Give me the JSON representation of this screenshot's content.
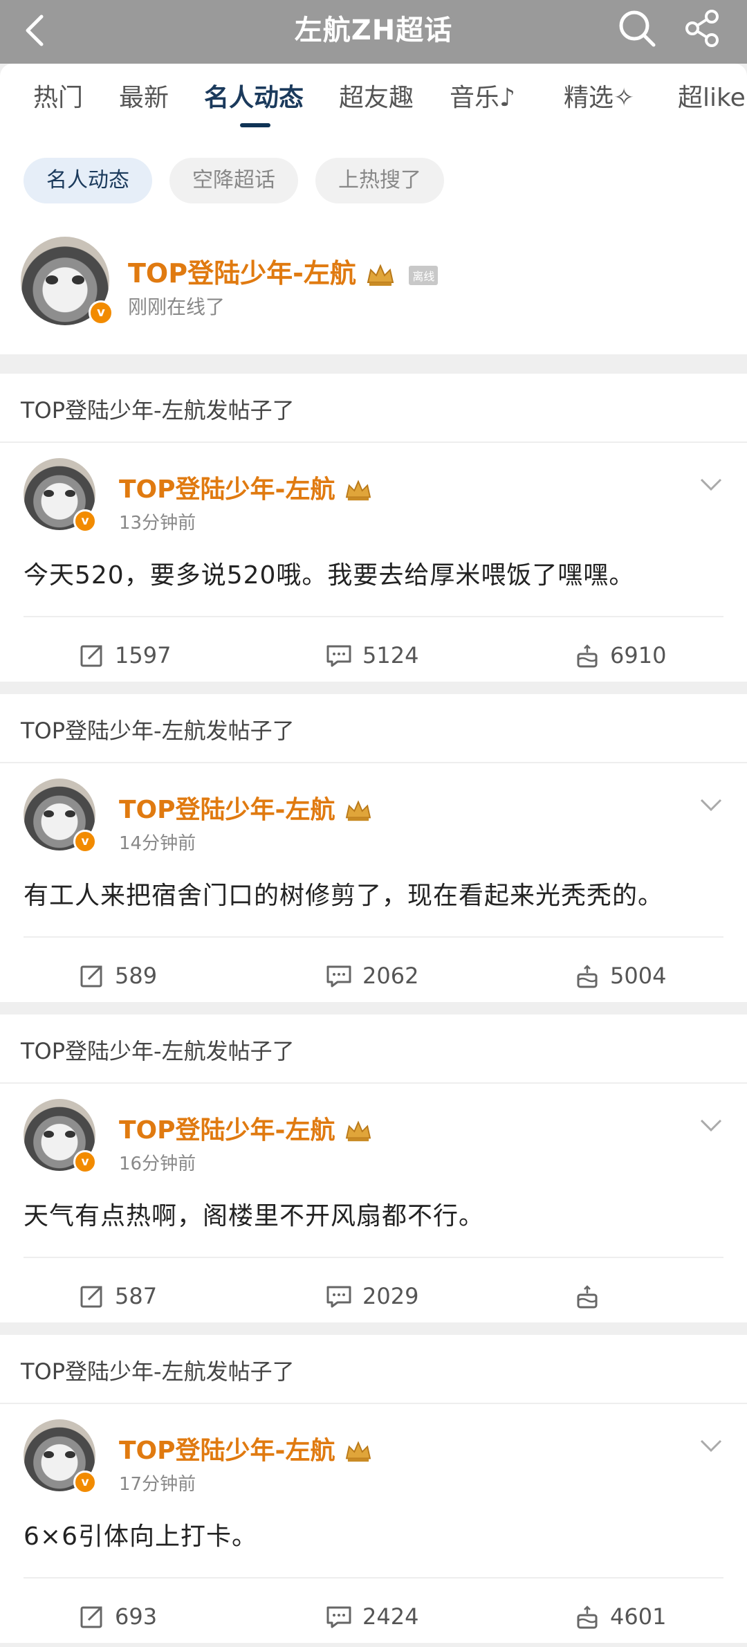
{
  "header": {
    "title": "左航ZH超话"
  },
  "tabs": [
    "热门",
    "最新",
    "名人动态",
    "超友趣",
    "音乐",
    "精选",
    "超like"
  ],
  "chips": [
    "名人动态",
    "空降超话",
    "上热搜了"
  ],
  "profile": {
    "name": "TOP登陆少年-左航",
    "tag": "离线",
    "status": "刚刚在线了"
  },
  "posts": [
    {
      "header": "TOP登陆少年-左航发帖子了",
      "author": "TOP登陆少年-左航",
      "time": "13分钟前",
      "text": "今天520，要多说520哦。我要去给厚米喂饭了嘿嘿。",
      "reposts": "1597",
      "comments": "5124",
      "likes": "6910"
    },
    {
      "header": "TOP登陆少年-左航发帖子了",
      "author": "TOP登陆少年-左航",
      "time": "14分钟前",
      "text": "有工人来把宿舍门口的树修剪了，现在看起来光秃秃的。",
      "reposts": "589",
      "comments": "2062",
      "likes": "5004"
    },
    {
      "header": "TOP登陆少年-左航发帖子了",
      "author": "TOP登陆少年-左航",
      "time": "16分钟前",
      "text": "天气有点热啊，阁楼里不开风扇都不行。",
      "reposts": "587",
      "comments": "2029",
      "likes": ""
    },
    {
      "header": "TOP登陆少年-左航发帖子了",
      "author": "TOP登陆少年-左航",
      "time": "17分钟前",
      "text": "6×6引体向上打卡。",
      "reposts": "693",
      "comments": "2424",
      "likes": "4601"
    }
  ],
  "colors": {
    "accent": "#e07a10",
    "tab_active": "#1b3a5c",
    "header_bg": "#9a9a9a"
  },
  "icons": {
    "back": "chevron-left-icon",
    "search": "search-icon",
    "share": "share-icon",
    "repost": "repost-icon",
    "comment": "comment-icon",
    "like": "like-icon",
    "crown": "crown-icon",
    "verified": "verified-badge-icon"
  }
}
